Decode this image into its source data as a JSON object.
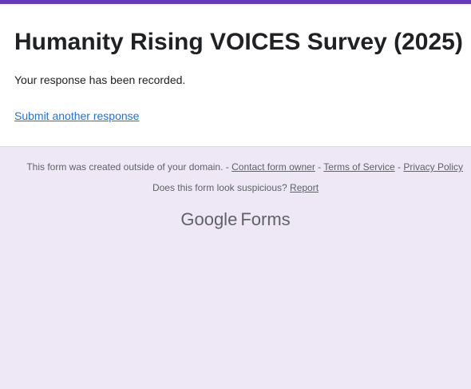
{
  "colors": {
    "accent": "#673ab7",
    "background": "#ede7f6",
    "link": "#1a73e8",
    "text": "#202124",
    "muted": "#5f6368"
  },
  "form": {
    "title": "Humanity Rising VOICES Survey (2025)",
    "confirmation_message": "Your response has been recorded.",
    "submit_another_label": "Submit another response"
  },
  "footer": {
    "domain_notice": "This form was created outside of your domain.",
    "separator": " - ",
    "contact_owner_label": "Contact form owner",
    "terms_label": "Terms of Service",
    "privacy_label": "Privacy Policy",
    "suspicious_question": "Does this form look suspicious?",
    "report_label": "Report"
  },
  "brand": {
    "google": "Google",
    "forms": "Forms",
    "icon": "google-forms-logo"
  }
}
